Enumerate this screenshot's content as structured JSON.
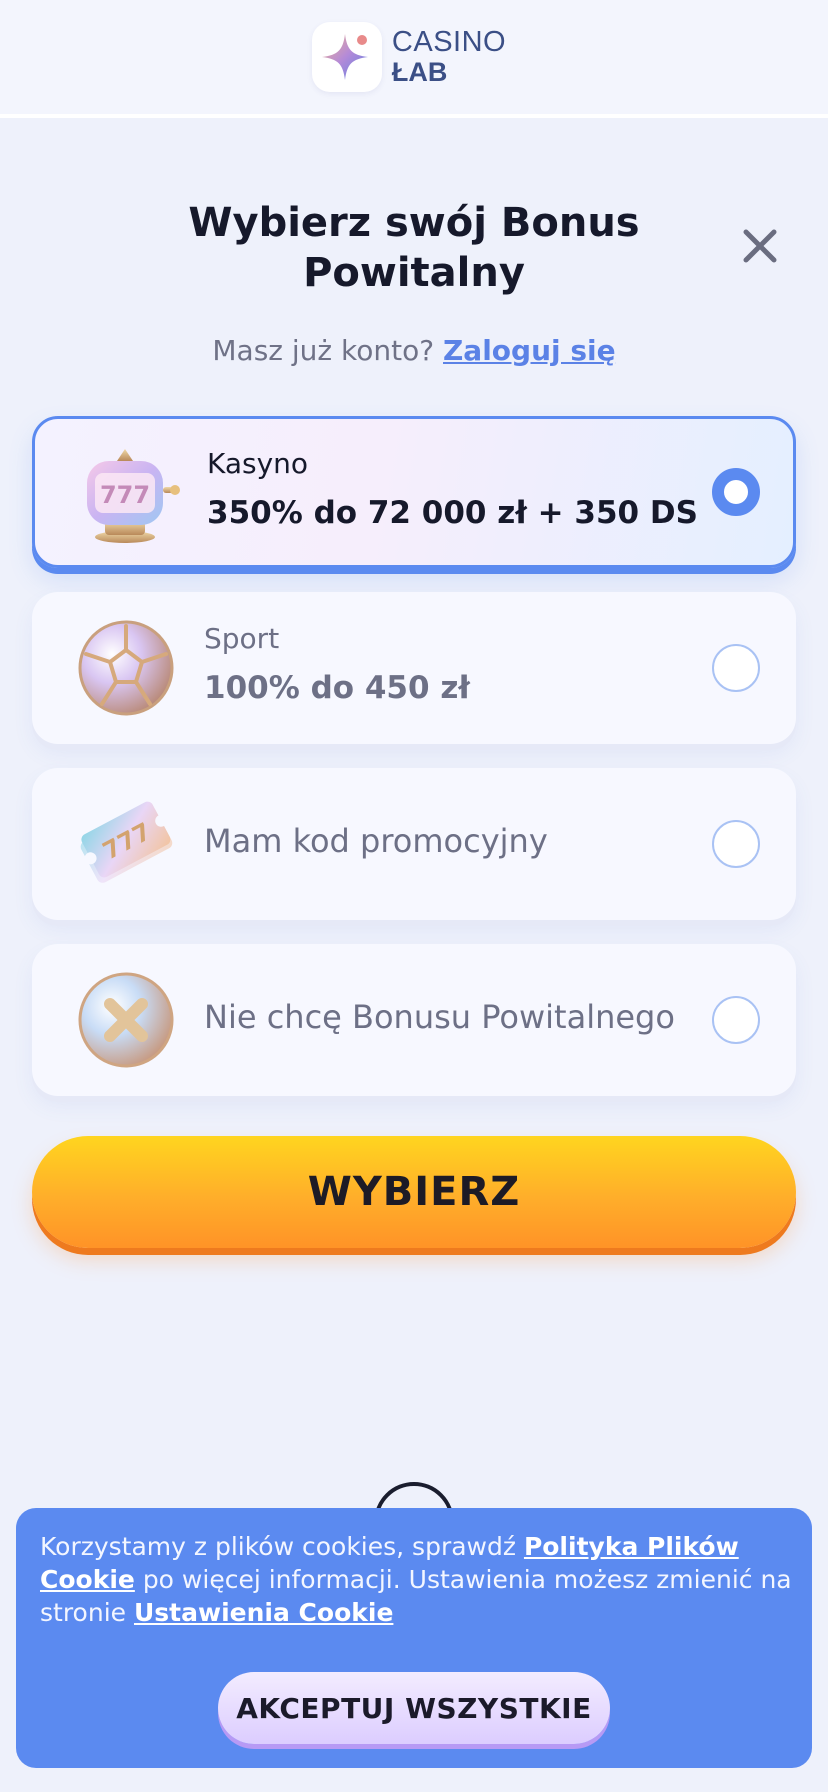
{
  "header": {
    "logo_line1": "CASINO",
    "logo_line2": "ŁAB"
  },
  "modal": {
    "title": "Wybierz swój Bonus Powitalny",
    "subtitle_prefix": "Masz już konto?",
    "login_link": "Zaloguj się",
    "options": [
      {
        "label": "Kasyno",
        "value": "350% do 72 000 zł + 350 DS",
        "icon": "slot-machine-icon",
        "selected": true
      },
      {
        "label": "Sport",
        "value": "100% do 450 zł",
        "icon": "football-icon",
        "selected": false
      },
      {
        "label": "Mam kod promocyjny",
        "icon": "promo-ticket-icon",
        "selected": false
      },
      {
        "label": "Nie chcę Bonusu Powitalnego",
        "icon": "no-bonus-icon",
        "selected": false
      }
    ],
    "submit_label": "WYBIERZ"
  },
  "cookie": {
    "text_1": "Korzystamy z plików cookies, sprawdź",
    "policy_link": "Polityka Plików Cookie",
    "text_2": "po więcej informacji. Ustawienia możesz zmienić na stronie",
    "settings_link": "Ustawienia Cookie",
    "accept_label": "AKCEPTUJ WSZYSTKIE"
  },
  "colors": {
    "accent": "#5b8af0",
    "button_yellow": "#ffd51f",
    "button_orange": "#ff9327",
    "background": "#eef1fb"
  }
}
